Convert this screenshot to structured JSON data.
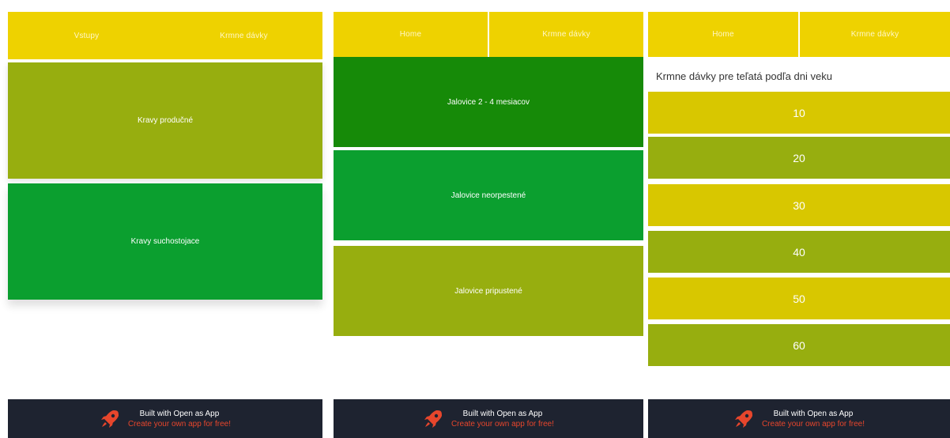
{
  "panels": [
    {
      "nav": [
        "Vstupy",
        "Krmne dávky"
      ],
      "blocks": [
        "Kravy produčné",
        "Kravy suchostojace"
      ]
    },
    {
      "nav": [
        "Home",
        "Krmne dávky"
      ],
      "blocks": [
        "Jalovice 2 - 4 mesiacov",
        "Jalovice neorpestené",
        "Jalovice pripustené"
      ]
    },
    {
      "nav": [
        "Home",
        "Krmne dávky"
      ],
      "heading": "Krmne dávky pre teľatá podľa dni veku",
      "rows": [
        "10",
        "20",
        "30",
        "40",
        "50",
        "60"
      ]
    }
  ],
  "footer": {
    "title": "Built with Open as App",
    "subtitle": "Create your own app for free!",
    "icon": "rocket-icon",
    "icon_color": "#e7462c"
  },
  "colors": {
    "nav": "#eed200",
    "olive": "#97ae0f",
    "green": "#0b9f2f",
    "dark_green": "#168a08",
    "yellow_row": "#d8c700",
    "footer_bg": "#1e2330"
  }
}
